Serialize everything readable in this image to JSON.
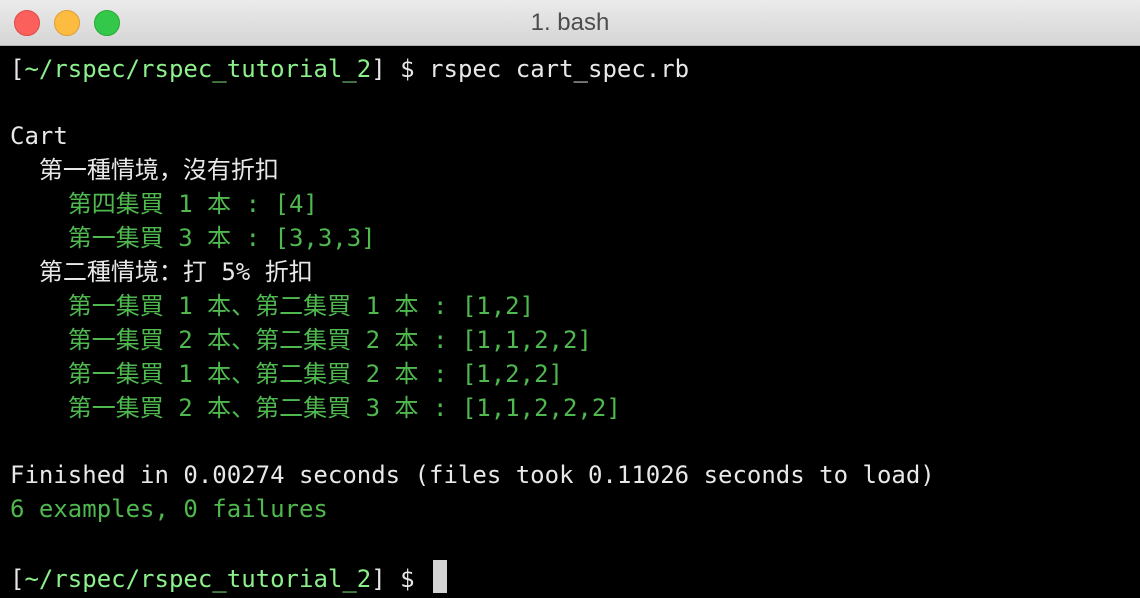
{
  "window": {
    "title": "1. bash"
  },
  "prompt": {
    "open_bracket": "[",
    "path": "~/rspec/rspec_tutorial_2",
    "close_bracket": "]",
    "symbol": " $ ",
    "command": "rspec cart_spec.rb"
  },
  "output": {
    "describe": "Cart",
    "context_1": "  第一種情境，沒有折扣",
    "context_1_examples": [
      "    第四集買 1 本 : [4]",
      "    第一集買 3 本 : [3,3,3]"
    ],
    "context_2": "  第二種情境：打 5% 折扣",
    "context_2_examples": [
      "    第一集買 1 本、第二集買 1 本 : [1,2]",
      "    第一集買 2 本、第二集買 2 本 : [1,1,2,2]",
      "    第一集買 1 本、第二集買 2 本 : [1,2,2]",
      "    第一集買 2 本、第二集買 3 本 : [1,1,2,2,2]"
    ],
    "finished": "Finished in 0.00274 seconds (files took 0.11026 seconds to load)",
    "summary": "6 examples, 0 failures"
  },
  "colors": {
    "pass_green": "#4fb84f",
    "prompt_path_green": "#8cf08c",
    "text": "#e8e8e8",
    "background": "#000000"
  }
}
